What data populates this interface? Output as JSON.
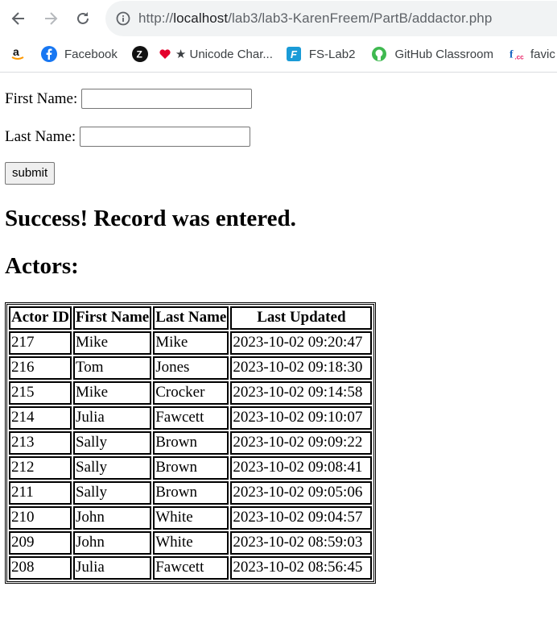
{
  "browser": {
    "url_prefix": "http://",
    "url_host": "localhost",
    "url_path": "/lab3/lab3-KarenFreem/PartB/addactor.php"
  },
  "bookmarks": [
    {
      "label": "",
      "icon": "amazon-icon"
    },
    {
      "label": "Facebook",
      "icon": "facebook-icon"
    },
    {
      "label": "",
      "icon": "circle-z-icon"
    },
    {
      "label": "★ Unicode Char...",
      "icon": "heart-icon"
    },
    {
      "label": "FS-Lab2",
      "icon": "f-logo-icon"
    },
    {
      "label": "GitHub Classroom",
      "icon": "github-icon"
    },
    {
      "label": "favic",
      "icon": "favicon-cc-icon"
    }
  ],
  "form": {
    "first_name_label": "First Name:",
    "first_name_value": "",
    "last_name_label": "Last Name:",
    "last_name_value": "",
    "submit_label": "submit"
  },
  "message": "Success! Record was entered.",
  "actors_heading": "Actors:",
  "table": {
    "headers": [
      "Actor ID",
      "First Name",
      "Last Name",
      "Last Updated"
    ],
    "rows": [
      [
        "217",
        "Mike",
        "Mike",
        "2023-10-02 09:20:47"
      ],
      [
        "216",
        "Tom",
        "Jones",
        "2023-10-02 09:18:30"
      ],
      [
        "215",
        "Mike",
        "Crocker",
        "2023-10-02 09:14:58"
      ],
      [
        "214",
        "Julia",
        "Fawcett",
        "2023-10-02 09:10:07"
      ],
      [
        "213",
        "Sally",
        "Brown",
        "2023-10-02 09:09:22"
      ],
      [
        "212",
        "Sally",
        "Brown",
        "2023-10-02 09:08:41"
      ],
      [
        "211",
        "Sally",
        "Brown",
        "2023-10-02 09:05:06"
      ],
      [
        "210",
        "John",
        "White",
        "2023-10-02 09:04:57"
      ],
      [
        "209",
        "John",
        "White",
        "2023-10-02 08:59:03"
      ],
      [
        "208",
        "Julia",
        "Fawcett",
        "2023-10-02 08:56:45"
      ]
    ]
  }
}
